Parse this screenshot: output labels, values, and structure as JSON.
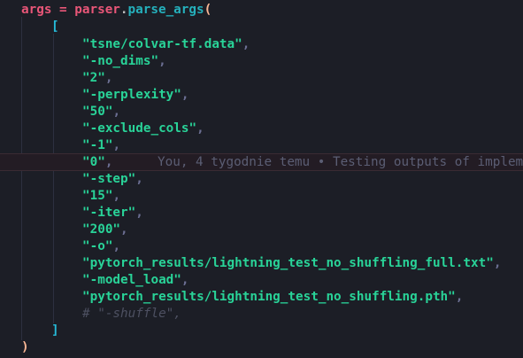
{
  "code": {
    "line1": {
      "var": "args",
      "assign": " = ",
      "obj": "parser",
      "dot": ".",
      "method": "parse_args",
      "open_paren": "("
    },
    "open_bracket": "[",
    "close_bracket": "]",
    "close_paren": ")",
    "comma": ",",
    "args": [
      "\"tsne/colvar-tf.data\"",
      "\"-no_dims\"",
      "\"2\"",
      "\"-perplexity\"",
      "\"50\"",
      "\"-exclude_cols\"",
      "\"-1\"",
      "\"0\"",
      "\"-step\"",
      "\"15\"",
      "\"-iter\"",
      "\"200\"",
      "\"-o\"",
      "\"pytorch_results/lightning_test_no_shuffling_full.txt\"",
      "\"-model_load\"",
      "\"pytorch_results/lightning_test_no_shuffling.pth\""
    ],
    "comment": "# \"-shuffle\","
  },
  "blame": {
    "text": "You, 4 tygodnie temu • Testing outputs of implem"
  }
}
